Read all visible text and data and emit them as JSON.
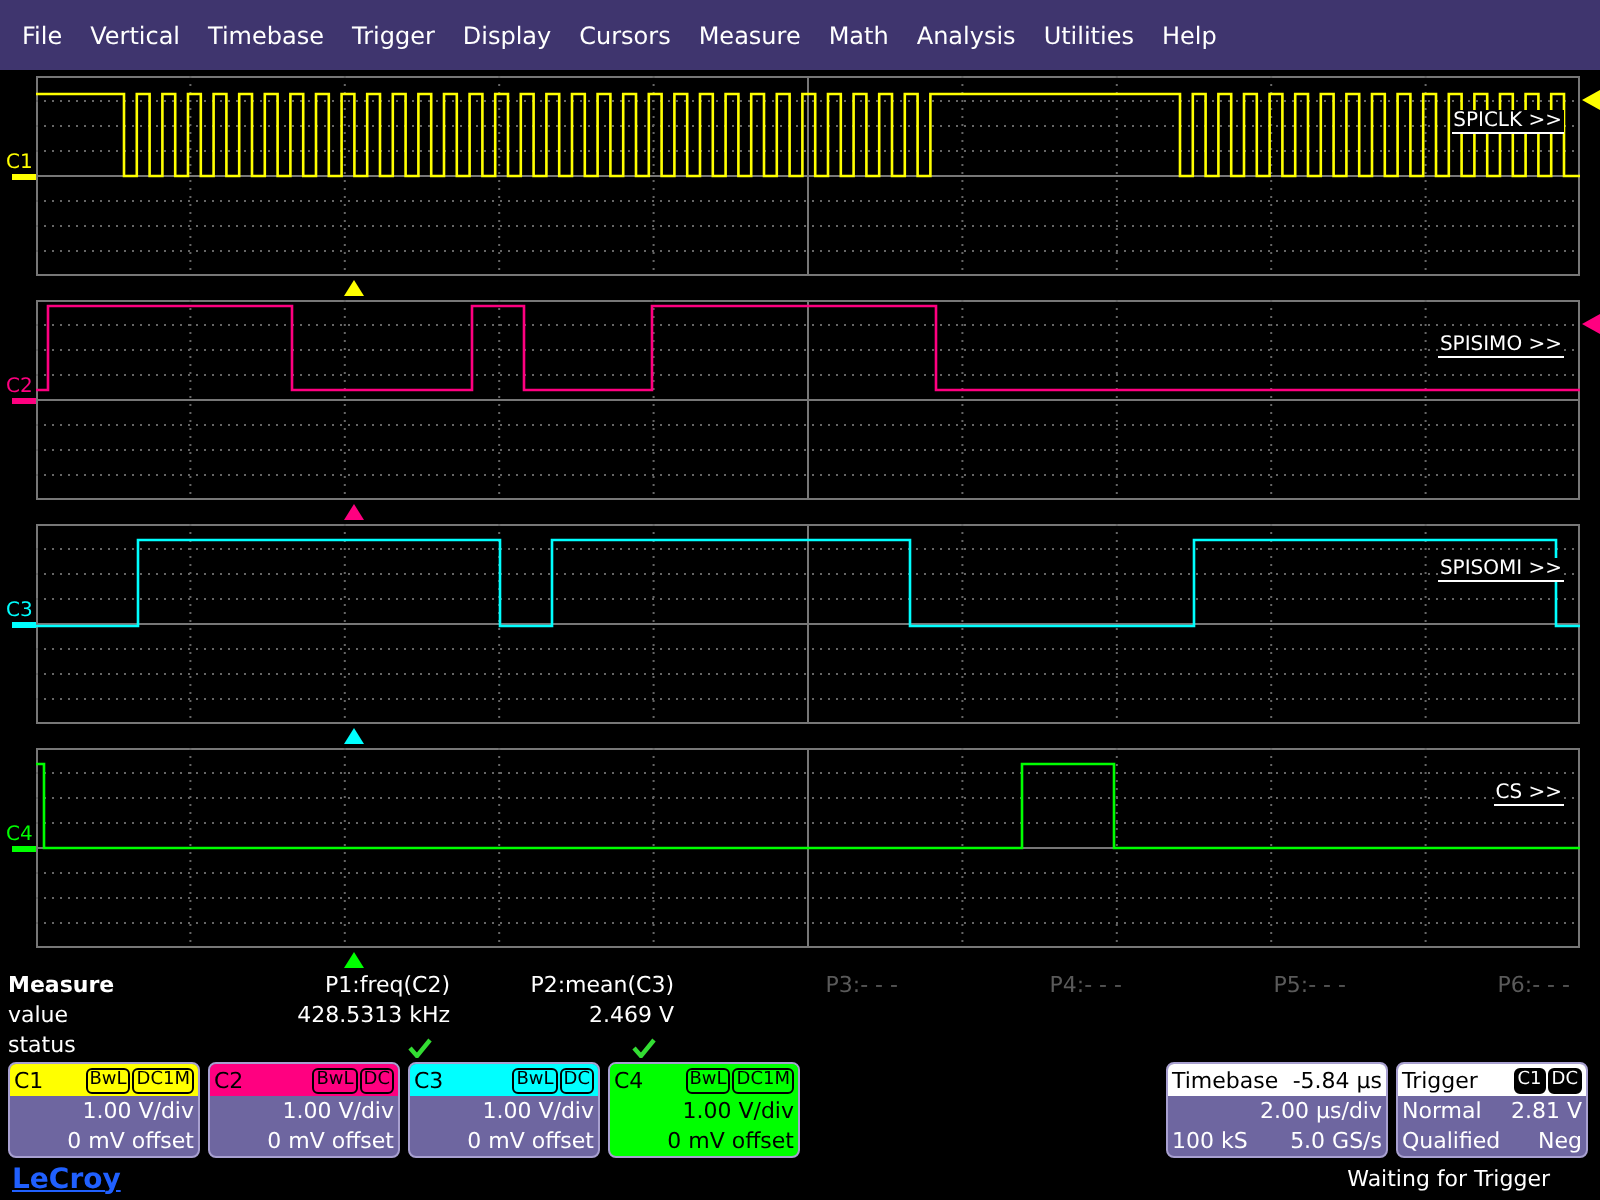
{
  "menu": [
    "File",
    "Vertical",
    "Timebase",
    "Trigger",
    "Display",
    "Cursors",
    "Measure",
    "Math",
    "Analysis",
    "Utilities",
    "Help"
  ],
  "traces": [
    {
      "label": "C1",
      "color": "#ffff00",
      "signal": "SPICLK >>",
      "trigger_level_marker": true
    },
    {
      "label": "C2",
      "color": "#ff0080",
      "signal": "SPISIMO >>",
      "trigger_level_marker": true
    },
    {
      "label": "C3",
      "color": "#00ffff",
      "signal": "SPISOMI >>",
      "trigger_level_marker": false
    },
    {
      "label": "C4",
      "color": "#00ff00",
      "signal": "CS >>",
      "trigger_level_marker": false
    }
  ],
  "measure": {
    "title": "Measure",
    "row_labels": [
      "value",
      "status"
    ],
    "params": [
      {
        "name": "P1:freq(C2)",
        "value": "428.5313 kHz",
        "enabled": true,
        "status_ok": true
      },
      {
        "name": "P2:mean(C3)",
        "value": "2.469 V",
        "enabled": true,
        "status_ok": true
      },
      {
        "name": "P3:- - -",
        "enabled": false,
        "status_ok": false
      },
      {
        "name": "P4:- - -",
        "enabled": false,
        "status_ok": false
      },
      {
        "name": "P5:- - -",
        "enabled": false,
        "status_ok": false
      },
      {
        "name": "P6:- - -",
        "enabled": false,
        "status_ok": false
      }
    ]
  },
  "channels": [
    {
      "label": "C1",
      "color": "#ffff00",
      "tags": [
        "BwL",
        "DC1M"
      ],
      "scale": "1.00 V/div",
      "offset": "0 mV offset",
      "selected": false
    },
    {
      "label": "C2",
      "color": "#ff0080",
      "tags": [
        "BwL",
        "DC"
      ],
      "scale": "1.00 V/div",
      "offset": "0 mV offset",
      "selected": false
    },
    {
      "label": "C3",
      "color": "#00ffff",
      "tags": [
        "BwL",
        "DC"
      ],
      "scale": "1.00 V/div",
      "offset": "0 mV offset",
      "selected": false
    },
    {
      "label": "C4",
      "color": "#00ff00",
      "tags": [
        "BwL",
        "DC1M"
      ],
      "scale": "1.00 V/div",
      "offset": "0 mV offset",
      "selected": true
    }
  ],
  "timebase": {
    "title": "Timebase",
    "delay": "-5.84 µs",
    "scale": "2.00 µs/div",
    "samples": "100 kS",
    "rate": "5.0 GS/s"
  },
  "trigger": {
    "title": "Trigger",
    "tags": [
      "C1",
      "DC"
    ],
    "mode": "Normal",
    "level": "2.81 V",
    "type": "Qualified",
    "slope": "Neg"
  },
  "footer": {
    "logo": "LeCroy",
    "status": "Waiting for Trigger"
  }
}
